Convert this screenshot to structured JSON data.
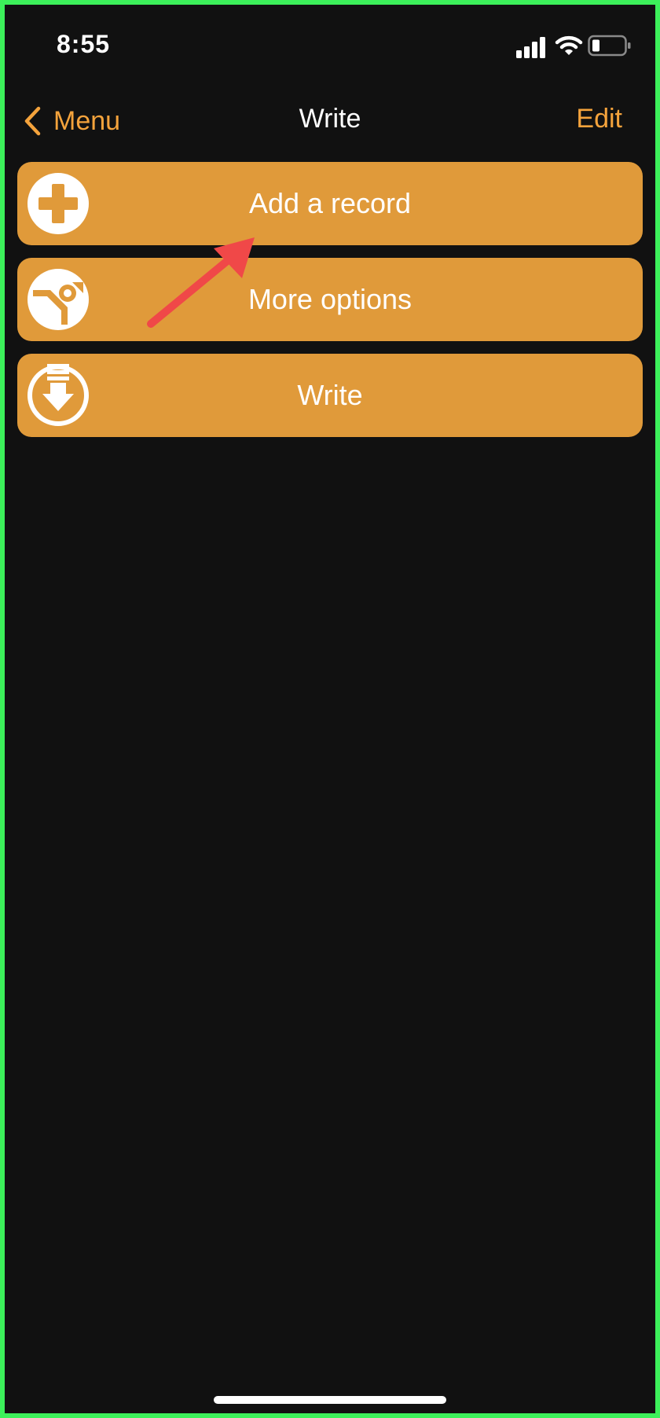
{
  "status_bar": {
    "time": "8:55",
    "signal_icon": "cellular-signal-icon",
    "wifi_icon": "wifi-icon",
    "battery_icon": "battery-low-icon"
  },
  "nav": {
    "back_label": "Menu",
    "back_icon": "chevron-left-icon",
    "title": "Write",
    "edit_label": "Edit"
  },
  "menu": {
    "items": [
      {
        "label": "Add a record",
        "icon": "plus-circle-icon"
      },
      {
        "label": "More options",
        "icon": "wrench-circle-icon"
      },
      {
        "label": "Write",
        "icon": "download-circle-icon"
      }
    ]
  },
  "colors": {
    "accent": "#f4a33c",
    "row_background": "#e09a3a",
    "background": "#111111",
    "frame_border": "#3cf05a",
    "annotation_arrow": "#f04848"
  }
}
